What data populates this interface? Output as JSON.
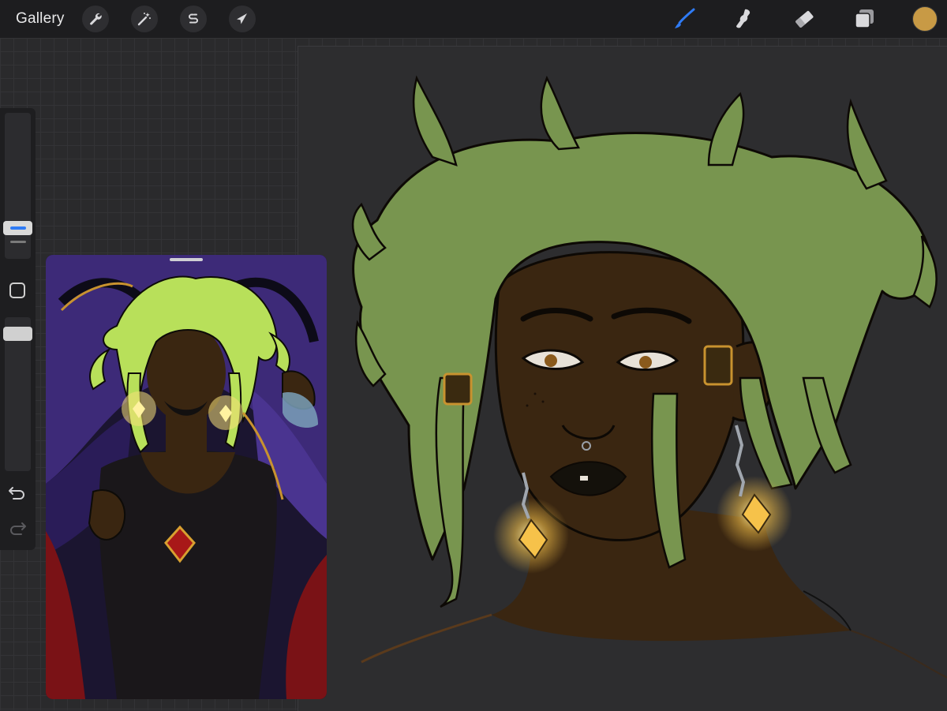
{
  "toolbar": {
    "gallery_label": "Gallery",
    "left_tools": [
      "wrench-icon",
      "magic-wand-icon",
      "selection-s-icon",
      "transform-arrow-icon"
    ],
    "right_tools": [
      "brush-icon",
      "smudge-icon",
      "eraser-icon",
      "layers-icon"
    ],
    "active_tool": "brush-icon",
    "accent_color": "#2f7bf5",
    "current_color": "#c89a45"
  },
  "sidebar": {
    "size_slider": "brush-size-slider",
    "modify_button": "modify-square",
    "opacity_slider": "brush-opacity-slider",
    "undo": "undo-icon",
    "redo": "redo-icon"
  },
  "canvas": {
    "background": "#2d2d2f",
    "hair_color": "#78954f",
    "skin_color": "#3a2611",
    "earring_glow": "#f6c24a"
  },
  "reference": {
    "palette": [
      "#4a2f8a",
      "#b8e05a",
      "#8a1a1a",
      "#1c1a1c",
      "#3a2611"
    ]
  }
}
